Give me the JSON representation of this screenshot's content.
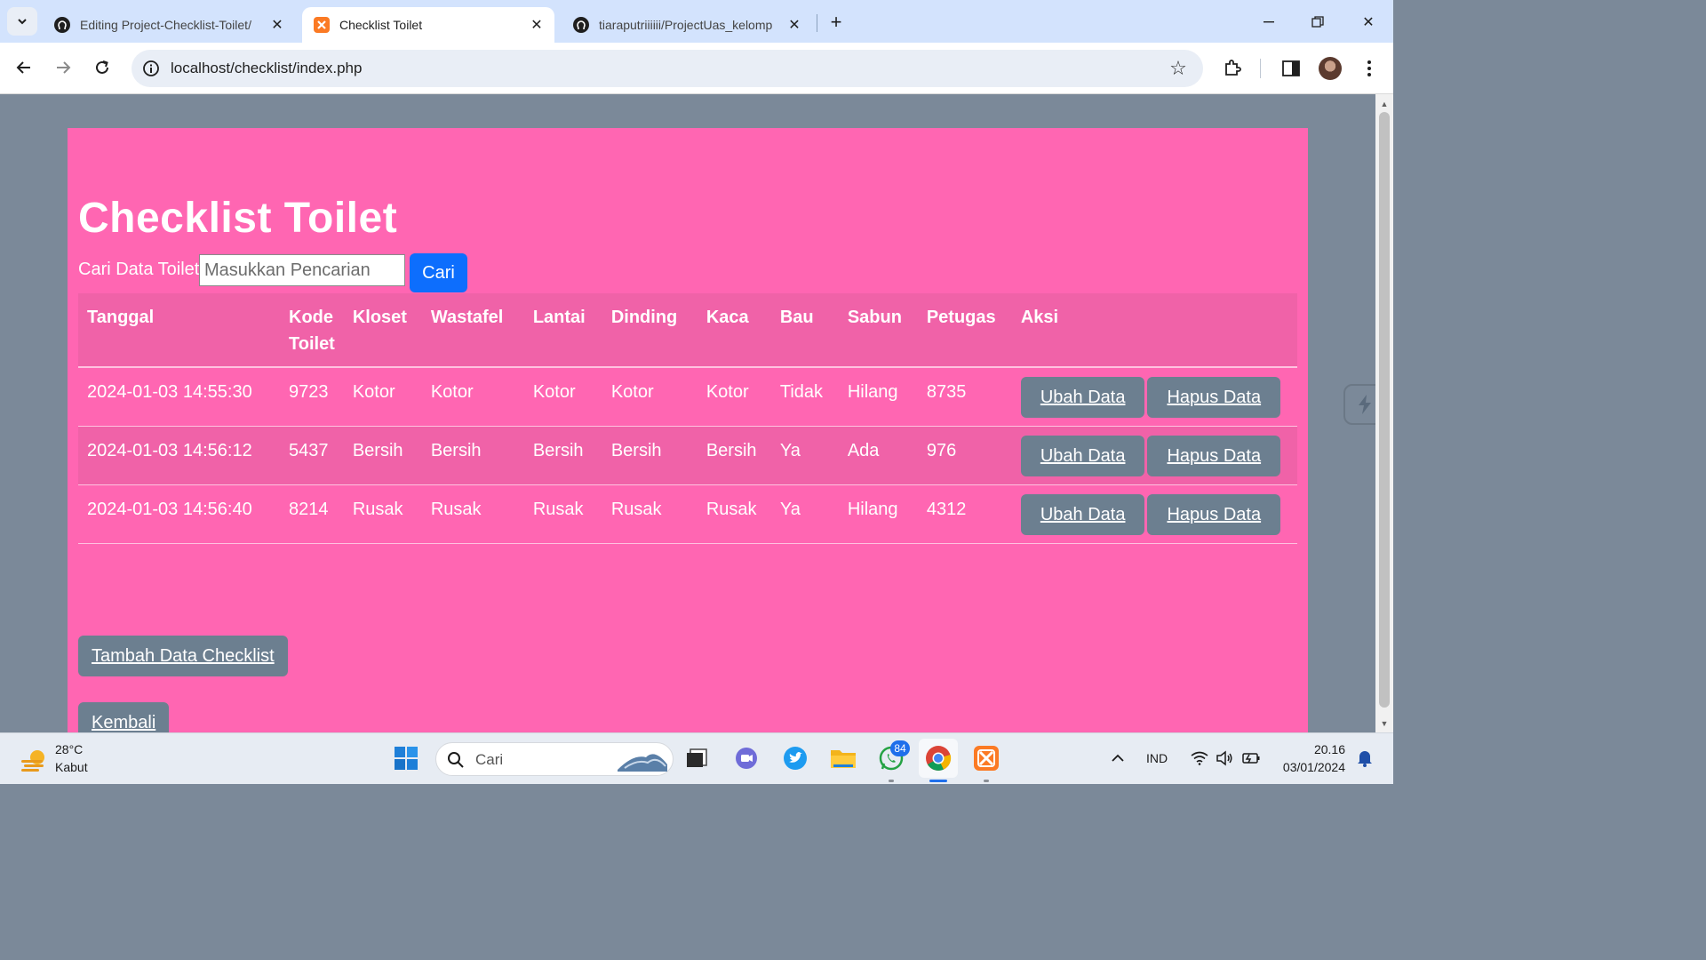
{
  "browser": {
    "tabs": [
      {
        "title": "Editing Project-Checklist-Toilet/",
        "favicon": "github-icon",
        "active": false
      },
      {
        "title": "Checklist Toilet",
        "favicon": "xampp-icon",
        "active": true
      },
      {
        "title": "tiaraputriiiiii/ProjectUas_kelomp",
        "favicon": "github-icon",
        "active": false
      }
    ],
    "url": "localhost/checklist/index.php"
  },
  "page": {
    "title": "Checklist Toilet",
    "search_label": "Cari Data Toilet",
    "search_placeholder": "Masukkan Pencarian",
    "search_button": "Cari",
    "table": {
      "headers": [
        "Tanggal",
        "Kode Toilet",
        "Kloset",
        "Wastafel",
        "Lantai",
        "Dinding",
        "Kaca",
        "Bau",
        "Sabun",
        "Petugas",
        "Aksi"
      ],
      "rows": [
        [
          "2024-01-03 14:55:30",
          "9723",
          "Kotor",
          "Kotor",
          "Kotor",
          "Kotor",
          "Kotor",
          "Tidak",
          "Hilang",
          "8735"
        ],
        [
          "2024-01-03 14:56:12",
          "5437",
          "Bersih",
          "Bersih",
          "Bersih",
          "Bersih",
          "Bersih",
          "Ya",
          "Ada",
          "976"
        ],
        [
          "2024-01-03 14:56:40",
          "8214",
          "Rusak",
          "Rusak",
          "Rusak",
          "Rusak",
          "Rusak",
          "Ya",
          "Hilang",
          "4312"
        ]
      ],
      "edit_label": "Ubah Data",
      "delete_label": "Hapus Data"
    },
    "add_button": "Tambah Data Checklist",
    "back_button": "Kembali",
    "colors": {
      "page_bg": "#7b8999",
      "container_bg": "#ff66b2",
      "primary": "#0d6efd",
      "secondary": "#6c7f90"
    }
  },
  "taskbar": {
    "temperature": "28°C",
    "weather": "Kabut",
    "search_label": "Cari",
    "whatsapp_badge": "84",
    "language": "IND",
    "time": "20.16",
    "date": "03/01/2024"
  }
}
